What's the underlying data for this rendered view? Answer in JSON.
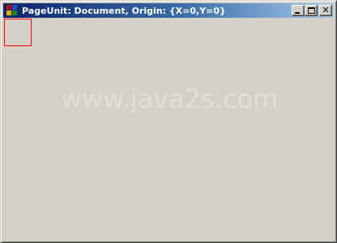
{
  "window": {
    "title": "PageUnit: Document, Origin: {X=0,Y=0}",
    "icon": "app-window-icon",
    "buttons": {
      "minimize_icon": "minimize-icon",
      "maximize_icon": "maximize-icon",
      "close_icon": "close-icon",
      "close_glyph": "✕"
    }
  },
  "client": {
    "background": "#d4d0c8",
    "rectangle_color": "#ff0000",
    "watermark": "www.java2s.com"
  }
}
